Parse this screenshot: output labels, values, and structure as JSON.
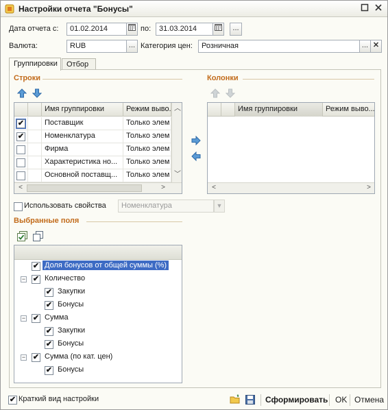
{
  "window": {
    "title": "Настройки отчета \"Бонусы\""
  },
  "header": {
    "date_label": "Дата отчета с:",
    "date_from": "01.02.2014",
    "date_to_label": "по:",
    "date_to": "31.03.2014",
    "period_button": "...",
    "currency_label": "Валюта:",
    "currency": "RUB",
    "price_category_label": "Категория цен:",
    "price_category": "Розничная",
    "select_button": "...",
    "clear_button": "✕"
  },
  "tabs": [
    {
      "label": "Группировки",
      "active": true
    },
    {
      "label": "Отбор",
      "active": false
    }
  ],
  "rows_section": {
    "title": "Строки",
    "columns": [
      "Имя группировки",
      "Режим выво..."
    ],
    "items": [
      {
        "checked": true,
        "name": "Поставщик",
        "mode": "Только элем"
      },
      {
        "checked": true,
        "name": "Номенклатура",
        "mode": "Только элем"
      },
      {
        "checked": false,
        "name": "Фирма",
        "mode": "Только элем"
      },
      {
        "checked": false,
        "name": "Характеристика но...",
        "mode": "Только элем"
      },
      {
        "checked": false,
        "name": "Основной поставщ...",
        "mode": "Только элем"
      }
    ]
  },
  "columns_section": {
    "title": "Колонки",
    "columns": [
      "Имя группировки",
      "Режим выво..."
    ]
  },
  "use_properties": {
    "label": "Использовать свойства",
    "checked": false,
    "value": "Номенклатура"
  },
  "selected_fields": {
    "title": "Выбранные поля",
    "items": [
      {
        "label": "Доля бонусов от общей суммы (%)",
        "level": 0,
        "checked": true,
        "expander": "",
        "selected": true
      },
      {
        "label": "Количество",
        "level": 0,
        "checked": true,
        "expander": "−",
        "selected": false
      },
      {
        "label": "Закупки",
        "level": 1,
        "checked": true,
        "expander": "",
        "selected": false
      },
      {
        "label": "Бонусы",
        "level": 1,
        "checked": true,
        "expander": "",
        "selected": false
      },
      {
        "label": "Сумма",
        "level": 0,
        "checked": true,
        "expander": "−",
        "selected": false
      },
      {
        "label": "Закупки",
        "level": 1,
        "checked": true,
        "expander": "",
        "selected": false
      },
      {
        "label": "Бонусы",
        "level": 1,
        "checked": true,
        "expander": "",
        "selected": false
      },
      {
        "label": "Сумма (по кат. цен)",
        "level": 0,
        "checked": true,
        "expander": "−",
        "selected": false
      },
      {
        "label": "Бонусы",
        "level": 1,
        "checked": true,
        "expander": "",
        "selected": false
      }
    ]
  },
  "footer": {
    "short_view_label": "Краткий вид настройки",
    "short_view_checked": true,
    "generate_button": "Сформировать",
    "ok_button": "OK",
    "cancel_button": "Отмена"
  },
  "colors": {
    "section_title": "#c26b1b",
    "selection": "#3d6bc4",
    "arrow_blue": "#3b82c4"
  },
  "icons": {
    "move_up": "move-up-icon",
    "move_down": "move-down-icon",
    "move_right": "move-right-icon",
    "move_left": "move-left-icon",
    "check_all": "check-all-icon",
    "copy": "copy-icon",
    "open": "open-folder-icon",
    "save": "save-icon"
  }
}
